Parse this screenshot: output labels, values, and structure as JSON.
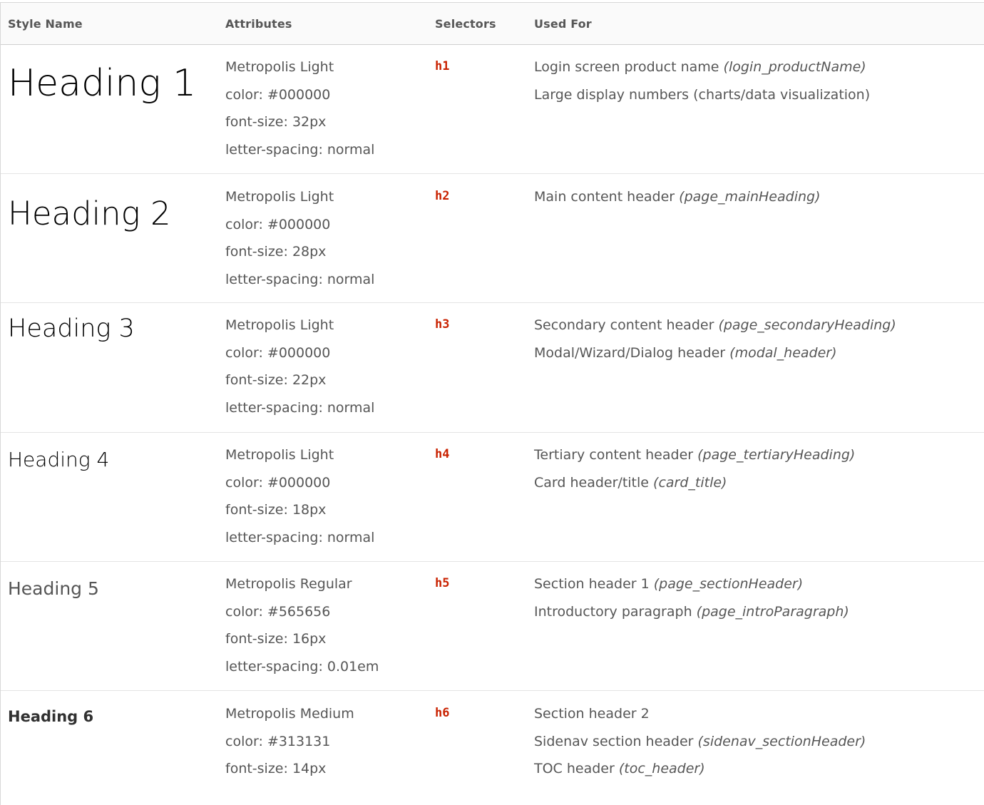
{
  "headers": {
    "style_name": "Style Name",
    "attributes": "Attributes",
    "selectors": "Selectors",
    "used_for": "Used For"
  },
  "rows": [
    {
      "name": "Heading 1",
      "attributes": [
        "Metropolis Light",
        "color: #000000",
        "font-size: 32px",
        "letter-spacing: normal"
      ],
      "selector": "h1",
      "uses": [
        {
          "text": "Login screen product name",
          "note": "(login_productName)"
        },
        {
          "text": "Large display numbers (charts/data visualization)",
          "note": ""
        }
      ]
    },
    {
      "name": "Heading 2",
      "attributes": [
        "Metropolis Light",
        "color: #000000",
        "font-size: 28px",
        "letter-spacing: normal"
      ],
      "selector": "h2",
      "uses": [
        {
          "text": "Main content header",
          "note": "(page_mainHeading)"
        }
      ]
    },
    {
      "name": "Heading 3",
      "attributes": [
        "Metropolis Light",
        "color: #000000",
        "font-size: 22px",
        "letter-spacing: normal"
      ],
      "selector": "h3",
      "uses": [
        {
          "text": "Secondary content header",
          "note": "(page_secondaryHeading)"
        },
        {
          "text": "Modal/Wizard/Dialog header",
          "note": "(modal_header)"
        }
      ]
    },
    {
      "name": "Heading 4",
      "attributes": [
        "Metropolis Light",
        "color: #000000",
        "font-size: 18px",
        "letter-spacing: normal"
      ],
      "selector": "h4",
      "uses": [
        {
          "text": "Tertiary content header",
          "note": "(page_tertiaryHeading)"
        },
        {
          "text": "Card header/title",
          "note": "(card_title)"
        }
      ]
    },
    {
      "name": "Heading 5",
      "attributes": [
        "Metropolis Regular",
        "color: #565656",
        "font-size: 16px",
        "letter-spacing: 0.01em"
      ],
      "selector": "h5",
      "uses": [
        {
          "text": "Section header 1",
          "note": "(page_sectionHeader)"
        },
        {
          "text": "Introductory paragraph",
          "note": "(page_introParagraph)"
        }
      ]
    },
    {
      "name": "Heading 6",
      "attributes": [
        "Metropolis Medium",
        "color: #313131",
        "font-size: 14px"
      ],
      "selector": "h6",
      "uses": [
        {
          "text": "Section header 2",
          "note": ""
        },
        {
          "text": "Sidenav section header",
          "note": "(sidenav_sectionHeader)"
        },
        {
          "text": "TOC header",
          "note": "(toc_header)"
        }
      ]
    }
  ]
}
